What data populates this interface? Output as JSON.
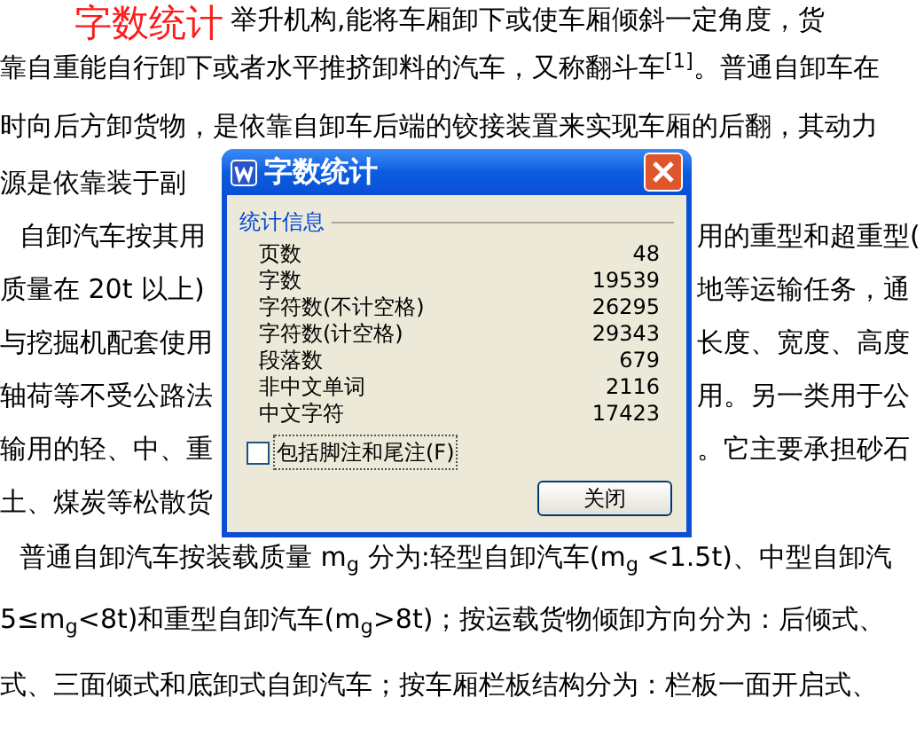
{
  "overlay_title": "字数统计",
  "document_lines": [
    {
      "left": "举升机构,能将车厢卸下或使车厢倾斜一定角度，货",
      "kind": "after_title"
    },
    {
      "left": "靠自重能自行卸下或者水平推挤卸料的汽车，又称翻斗车$^{[1]}$。普通自卸车在",
      "kind": "continuation"
    },
    {
      "left": "时向后方卸货物，是依靠自卸车后端的铰接装置来实现车厢的后翻，其动力",
      "kind": "continuation"
    },
    {
      "left": "源是依靠装于副",
      "kind": "continuation"
    },
    {
      "left": "自卸汽车按其用",
      "right": "用的重型和超重型(",
      "kind": "paragraph_start"
    },
    {
      "left": "质量在 20t 以上)",
      "right": "地等运输任务，通",
      "kind": "continuation"
    },
    {
      "left": "与挖掘机配套使用",
      "right": "长度、宽度、高度",
      "kind": "continuation"
    },
    {
      "left": "轴荷等不受公路法",
      "right": "用。另一类用于公",
      "kind": "continuation"
    },
    {
      "left": "输用的轻、中、重",
      "right": "。它主要承担砂石",
      "kind": "continuation"
    },
    {
      "left": "土、煤炭等松散货",
      "kind": "continuation"
    },
    {
      "left": "普通自卸汽车按装载质量 m$_{g}$ 分为:轻型自卸汽车(m$_{g}$ <1.5t)、中型自卸汽",
      "kind": "paragraph_start"
    },
    {
      "left": "5≤m$_{g}$<8t)和重型自卸汽车(m$_{g}$>8t)；按运载货物倾卸方向分为：后倾式、",
      "kind": "continuation"
    },
    {
      "left": "式、三面倾式和底卸式自卸汽车；按车厢栏板结构分为：栏板一面开启式、",
      "kind": "continuation"
    }
  ],
  "dialog": {
    "title": "字数统计",
    "group_label": "统计信息",
    "stats": [
      {
        "label": "页数",
        "value": "48"
      },
      {
        "label": "字数",
        "value": "19539"
      },
      {
        "label": "字符数(不计空格)",
        "value": "26295"
      },
      {
        "label": "字符数(计空格)",
        "value": "29343"
      },
      {
        "label": "段落数",
        "value": "679"
      },
      {
        "label": "非中文单词",
        "value": "2116"
      },
      {
        "label": "中文字符",
        "value": "17423"
      }
    ],
    "checkbox": {
      "label": "包括脚注和尾注(F)",
      "checked": false
    },
    "buttons": [
      "关闭"
    ]
  }
}
